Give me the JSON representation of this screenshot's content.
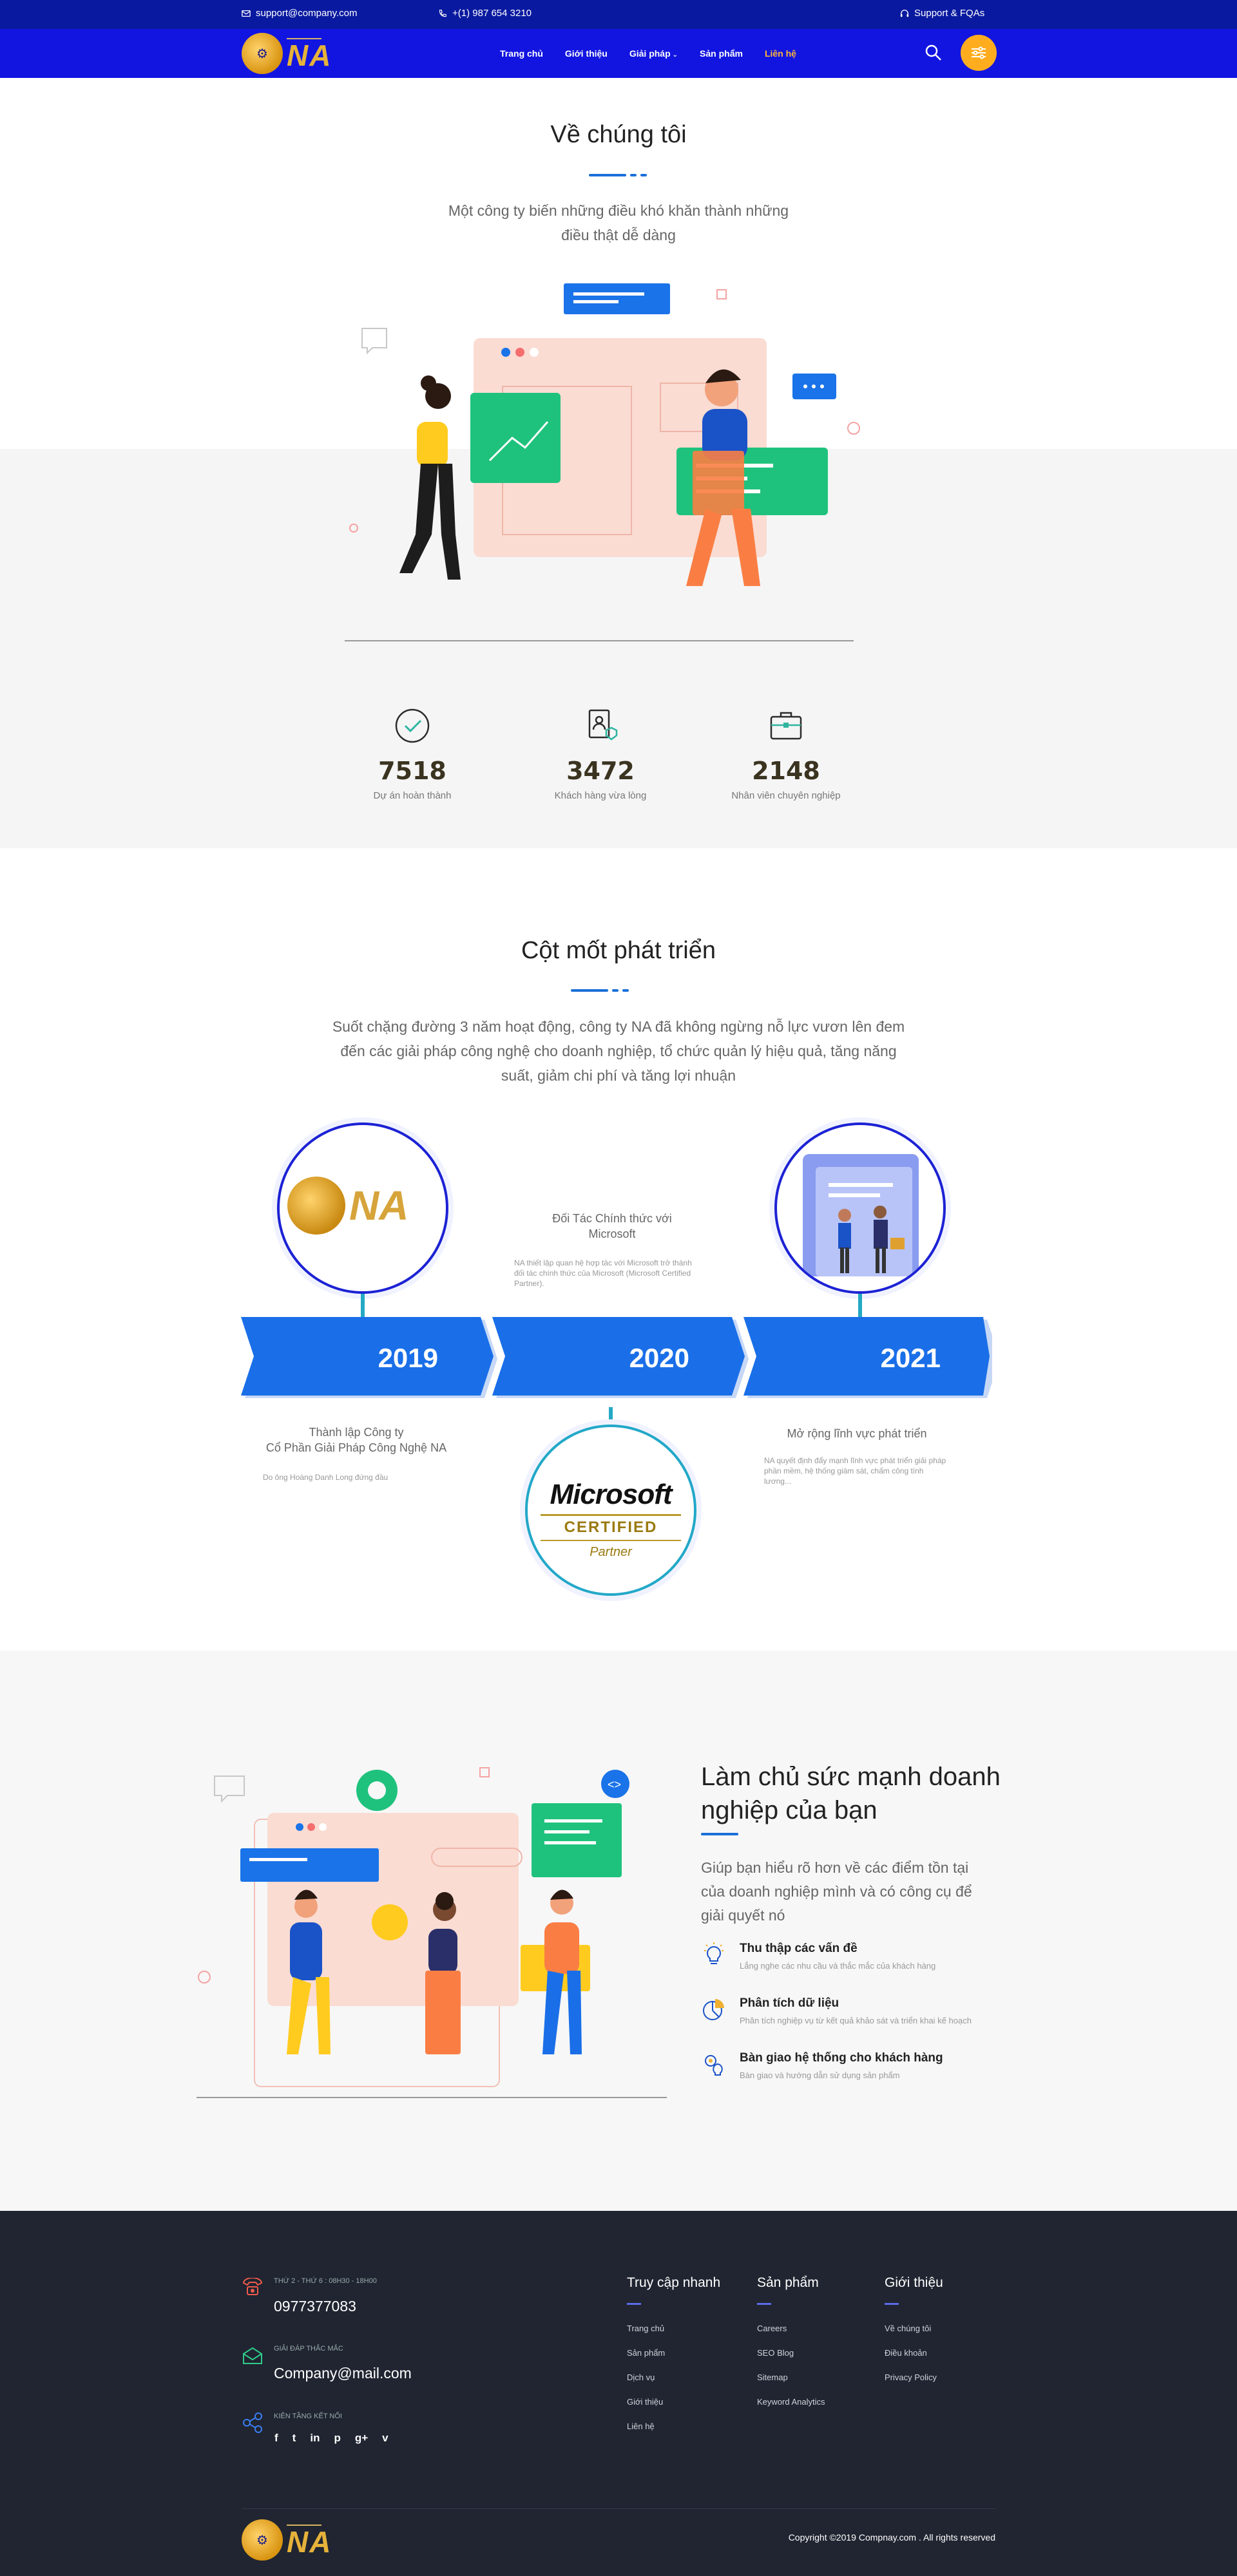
{
  "topbar": {
    "email": "support@company.com",
    "phone": "+(1) 987 654 3210",
    "support": "Support & FQAs"
  },
  "nav": {
    "items": [
      "Trang chủ",
      "Giới thiệu",
      "Giải pháp",
      "Sản phẩm",
      "Liên hệ"
    ],
    "active_color": "#ffb63a",
    "brand_color": "#1215e0"
  },
  "about": {
    "title": "Về chúng tôi",
    "lead_line1": "Một công ty biến những điều khó khăn thành những",
    "lead_line2": "điều thật dễ dàng",
    "stats": [
      {
        "icon": "check-circle-icon",
        "value": "7518",
        "label": "Dự án hoàn thành"
      },
      {
        "icon": "user-badge-icon",
        "value": "3472",
        "label": "Khách hàng vừa lòng"
      },
      {
        "icon": "briefcase-icon",
        "value": "2148",
        "label": "Nhân viên chuyên nghiệp"
      }
    ]
  },
  "timeline": {
    "title": "Cột mốt phát triển",
    "lead_line1": "Suốt chặng đường 3 năm hoạt động, công ty NA đã không ngừng nỗ lực vươn lên đem",
    "lead_line2": "đến các giải pháp công nghệ cho doanh nghiệp, tổ chức quản lý hiệu quả, tăng năng",
    "lead_line3": "suất, giảm chi phí và tăng lợi nhuận",
    "years": [
      "2019",
      "2020",
      "2021"
    ],
    "y2019_title1": "Thành lập Công ty",
    "y2019_title2": "Cổ Phần Giải Pháp Công Nghệ NA",
    "y2019_desc": "Do ông Hoàng Danh Long đứng đầu",
    "y2020_title1": "Đối Tác Chính thức với",
    "y2020_title2": "Microsoft",
    "y2020_desc": "NA thiết lập quan hệ hợp tác với Microsoft trở thành đối tác chính thức của Microsoft (Microsoft Certified Partner).",
    "y2021_title": "Mở rộng lĩnh vực phát triển",
    "y2021_desc": "NA quyết định đẩy mạnh lĩnh vực phát triển giải pháp phần mềm, hệ thống giám sát, chấm công tính lương...",
    "ms_word": "Microsoft",
    "ms_certified": "CERTIFIED",
    "ms_partner": "Partner"
  },
  "power": {
    "title_line1": "Làm chủ sức mạnh doanh",
    "title_line2": "nghiệp của bạn",
    "lead_line1": "Giúp bạn hiểu rõ hơn về các điểm tồn tại",
    "lead_line2": "của doanh nghiệp mình và có công cụ để",
    "lead_line3": "giải quyết nó",
    "features": [
      {
        "icon": "lightbulb-icon",
        "title": "Thu thập các vấn đề",
        "desc": "Lắng nghe các nhu cầu và thắc mắc của khách hàng"
      },
      {
        "icon": "pie-chart-icon",
        "title": "Phân tích dữ liệu",
        "desc": "Phân tích nghiệp vụ từ kết quả khảo sát và triển khai kế hoạch"
      },
      {
        "icon": "gear-bulb-icon",
        "title": "Bàn giao hệ thống cho khách hàng",
        "desc": "Bàn giao và hướng dẫn sử dụng sản phẩm"
      }
    ]
  },
  "footer": {
    "hours_label": "THỨ 2 - THỨ 6 : 08H30 - 18H00",
    "phone": "0977377083",
    "mail_label": "GIẢI ĐÁP THẮC MẮC",
    "mail": "Company@mail.com",
    "social_label": "KIÊN TẦNG KẾT NỐI",
    "social": [
      "f",
      "t",
      "in",
      "p",
      "g+",
      "v"
    ],
    "cols": [
      {
        "title": "Truy cập nhanh",
        "links": [
          "Trang chủ",
          "Sản phẩm",
          "Dịch vụ",
          "Giới thiệu",
          "Liên hệ"
        ]
      },
      {
        "title": "Sản phẩm",
        "links": [
          "Careers",
          "SEO Blog",
          "Sitemap",
          "Keyword Analytics"
        ]
      },
      {
        "title": "Giới thiệu",
        "links": [
          "Về chúng tôi",
          "Điều khoản",
          "Privacy Policy"
        ]
      }
    ],
    "copyright": "Copyright ©2019 Compnay.com . All rights reserved"
  }
}
